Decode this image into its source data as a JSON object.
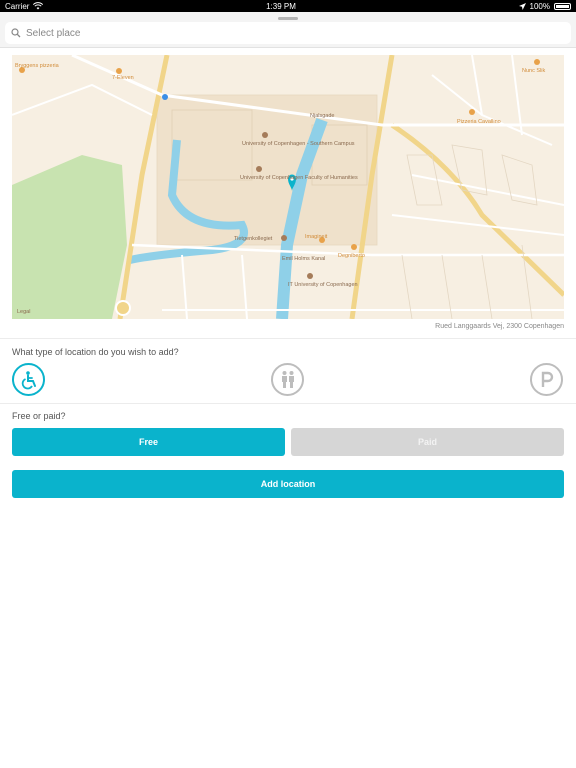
{
  "status_bar": {
    "carrier": "Carrier",
    "time": "1:39 PM",
    "battery": "100%"
  },
  "search": {
    "placeholder": "Select place"
  },
  "map": {
    "labels": {
      "pizzeria": "Bryggens pizzeria",
      "seven_eleven": "7-Eleven",
      "southern_campus": "University of Copenhagen - Southern Campus",
      "faculty": "University of Copenhagen Faculty of Humanities",
      "nunc_slik": "Nunc Slik",
      "cavallino": "Pizzeria Cavallino",
      "njalsgade": "Njalsgade",
      "kollegiet": "Tietgenkollegiet",
      "imagine": "Imagineit",
      "degniberto": "Degniberto",
      "emil_holms": "Emil Holms Kanal",
      "it_university": "IT University of Copenhagen",
      "legal": "Legal"
    }
  },
  "address": "Rued Langgaards Vej, 2300 Copenhagen",
  "location_question": "What type of location do you wish to add?",
  "location_types": [
    {
      "icon": "wheelchair-icon",
      "active": true
    },
    {
      "icon": "family-icon",
      "active": false
    },
    {
      "icon": "parking-icon",
      "active": false
    }
  ],
  "payment_question": "Free or paid?",
  "buttons": {
    "free": "Free",
    "paid": "Paid",
    "add": "Add location"
  },
  "colors": {
    "accent": "#0ab3cc",
    "inactive": "#d6d6d6"
  }
}
